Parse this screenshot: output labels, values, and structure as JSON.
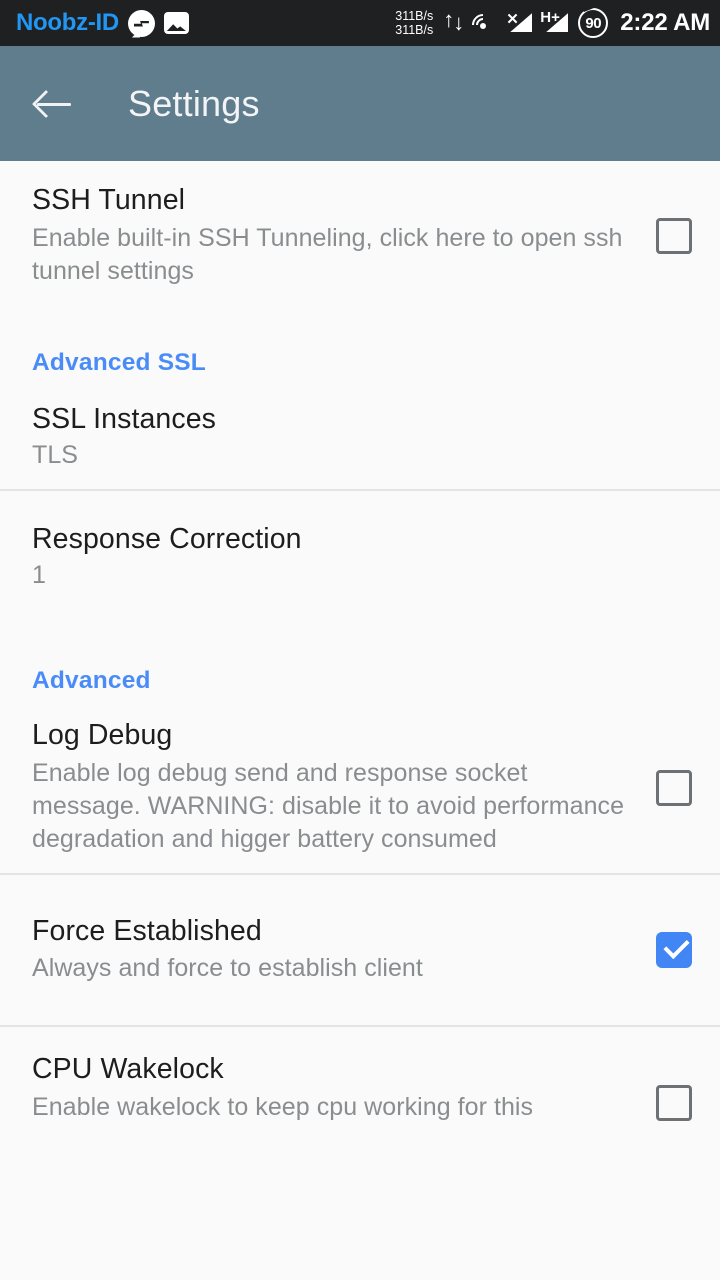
{
  "status_bar": {
    "app_name": "Noobz-ID",
    "icons": [
      "messenger-icon",
      "photo-icon",
      "data-transfer-icon",
      "cast-icon",
      "signal-no-service-icon",
      "signal-hplus-icon"
    ],
    "net_speed_up": "311B/s",
    "net_speed_down": "311B/s",
    "mobile_data_type": "H+",
    "battery_level": "90",
    "clock": "2:22 AM",
    "background_color": "#1f2021",
    "app_name_color": "#2196f3"
  },
  "app_bar": {
    "title": "Settings",
    "back_label": "back-arrow",
    "background_color": "#5f7d8c",
    "title_color": "#f2f4f5"
  },
  "theme": {
    "page_background": "#fafafa",
    "accent_blue": "#4a8cf7",
    "checkbox_checked": "#4285f4",
    "checkbox_outline": "#6e7174",
    "title_color": "#1d1d1d",
    "summary_color": "#8a8d8f",
    "divider_color": "#e4e4e4"
  },
  "preferences": [
    {
      "key": "ssh_tunnel",
      "title": "SSH Tunnel",
      "summary": "Enable built-in SSH Tunneling, click here to open ssh tunnel settings",
      "widget": "checkbox",
      "checked": false
    },
    {
      "key": "ssl_instances",
      "title": "SSL Instances",
      "summary": "TLS",
      "widget": "none"
    },
    {
      "key": "response_correction",
      "title": "Response Correction",
      "summary": "1",
      "widget": "none"
    },
    {
      "key": "log_debug",
      "title": "Log Debug",
      "summary": "Enable log debug send and response socket message. WARNING: disable it to avoid performance degradation and higger battery consumed",
      "widget": "checkbox",
      "checked": false
    },
    {
      "key": "force_established",
      "title": "Force Established",
      "summary": "Always and force to establish client",
      "widget": "checkbox",
      "checked": true
    },
    {
      "key": "cpu_wakelock",
      "title": "CPU Wakelock",
      "summary": "Enable wakelock to keep cpu working for this",
      "widget": "checkbox",
      "checked": false
    }
  ],
  "section_headers": {
    "advanced_ssl": "Advanced SSL",
    "advanced": "Advanced"
  }
}
